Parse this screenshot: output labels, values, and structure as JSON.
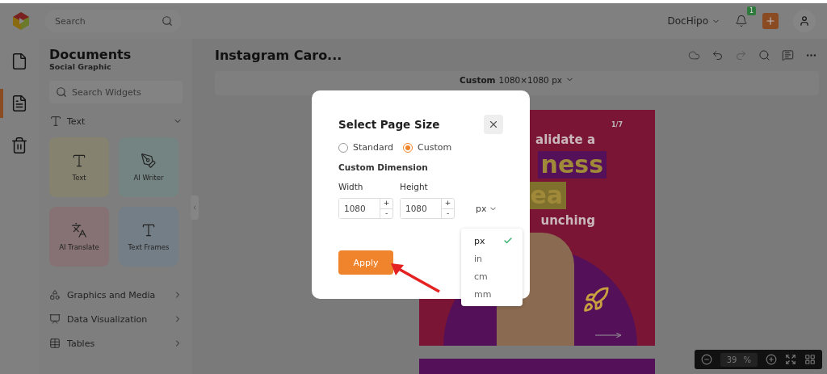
{
  "topbar": {
    "search_placeholder": "Search",
    "account": "DocHipo",
    "notification_count": "1"
  },
  "rail": [
    {
      "kind": "file",
      "selected": false
    },
    {
      "kind": "document",
      "selected": true
    },
    {
      "kind": "trash",
      "selected": false
    }
  ],
  "sidebar": {
    "title": "Documents",
    "subtitle": "Social Graphic",
    "search_placeholder": "Search Widgets",
    "section": {
      "label": "Text",
      "expanded": true
    },
    "widgets": [
      {
        "label": "Text",
        "kind": "text",
        "color": "#85836f"
      },
      {
        "label": "AI Writer",
        "kind": "writer",
        "color": "#748482"
      },
      {
        "label": "AI Translate",
        "kind": "translate",
        "color": "#867274"
      },
      {
        "label": "Text Frames",
        "kind": "frames",
        "color": "#747e86"
      }
    ],
    "categories": [
      {
        "label": "Graphics and Media",
        "kind": "graphics"
      },
      {
        "label": "Data Visualization",
        "kind": "dataviz"
      },
      {
        "label": "Tables",
        "kind": "tables"
      }
    ]
  },
  "document": {
    "title": "Instagram Caro...",
    "page_size": {
      "kind": "Custom",
      "size": "1080×1080 px"
    },
    "design": {
      "page": "1/7",
      "lines": [
        {
          "text": "alidate a",
          "kind": "plain"
        },
        {
          "text": "ness",
          "kind": "purple"
        },
        {
          "text": "ea",
          "kind": "gold"
        },
        {
          "text": "unching",
          "kind": "plain"
        }
      ]
    },
    "zoom": {
      "value": "39",
      "unit": "%"
    }
  },
  "modal": {
    "title": "Select Page Size",
    "options": [
      {
        "label": "Standard",
        "selected": false
      },
      {
        "label": "Custom",
        "selected": true
      }
    ],
    "section": "Custom Dimension",
    "increment": "+",
    "decrement": "-",
    "fields": [
      {
        "label": "Width",
        "value": "1080"
      },
      {
        "label": "Height",
        "value": "1080"
      }
    ],
    "unit": "px",
    "unit_menu": {
      "options": [
        {
          "label": "px",
          "selected": true
        },
        {
          "label": "in",
          "selected": false
        },
        {
          "label": "cm",
          "selected": false
        },
        {
          "label": "mm",
          "selected": false
        }
      ]
    },
    "apply": "Apply"
  }
}
